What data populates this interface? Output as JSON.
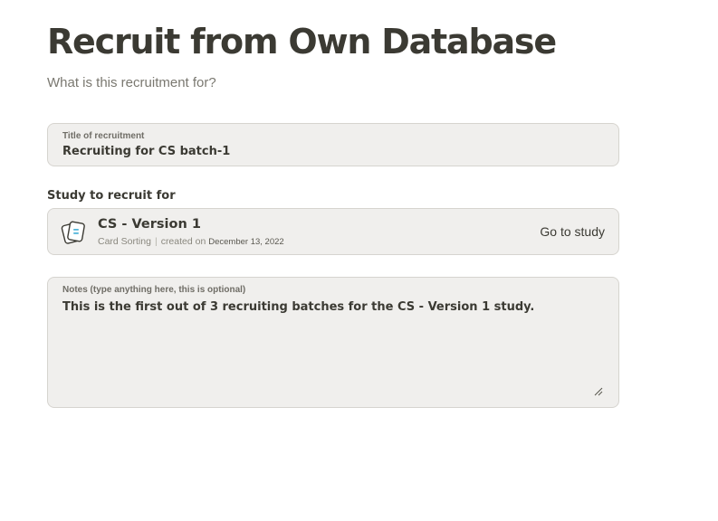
{
  "header": {
    "title": "Recruit from Own Database",
    "subtitle": "What is this recruitment for?"
  },
  "recruitment_title": {
    "label": "Title of recruitment",
    "value": "Recruiting for CS batch-1"
  },
  "study": {
    "section_label": "Study to recruit for",
    "icon": "card-sorting-icon",
    "name": "CS - Version 1",
    "type": "Card Sorting",
    "separator": "|",
    "created_prefix": "created on",
    "created_date": "December 13, 2022",
    "go_label": "Go to study"
  },
  "notes": {
    "label": "Notes (type anything here, this is optional)",
    "value": "This is the first out of 3 recruiting batches for the CS - Version 1 study."
  },
  "colors": {
    "text": "#3b3a33",
    "field_bg": "#f0efed",
    "field_border": "#d6d4cf",
    "icon_accent": "#4fb3d9"
  }
}
